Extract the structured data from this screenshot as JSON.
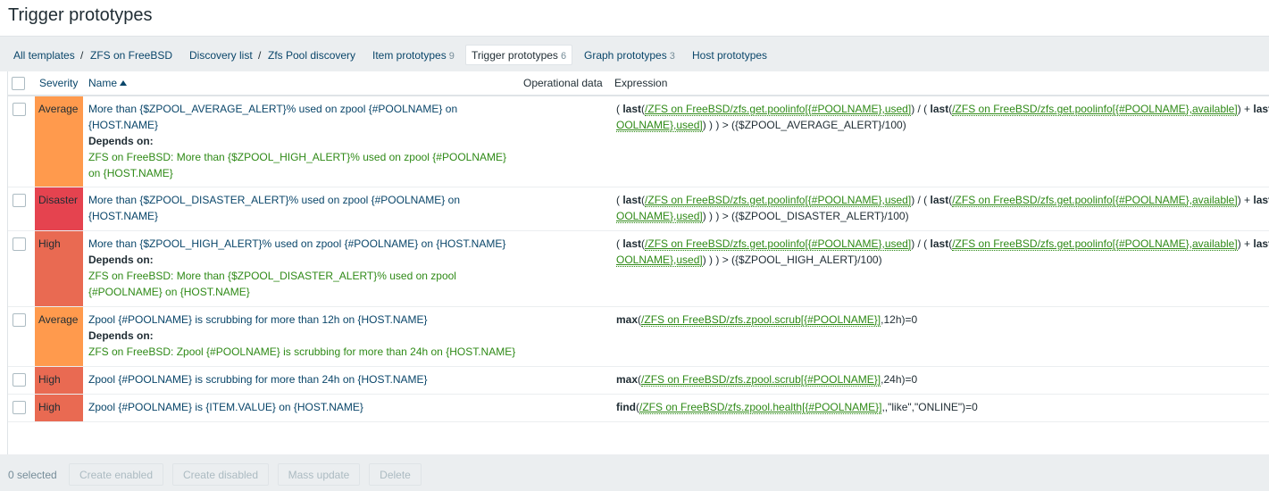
{
  "page": {
    "title": "Trigger prototypes"
  },
  "breadcrumb": {
    "all_templates": "All templates",
    "template": "ZFS on FreeBSD",
    "discovery_list": "Discovery list",
    "discovery_rule": "Zfs Pool discovery",
    "separator": "/",
    "item_prototypes": {
      "label": "Item prototypes",
      "count": "9"
    },
    "trigger_prototypes": {
      "label": "Trigger prototypes",
      "count": "6"
    },
    "graph_prototypes": {
      "label": "Graph prototypes",
      "count": "3"
    },
    "host_prototypes": {
      "label": "Host prototypes"
    }
  },
  "table": {
    "columns": {
      "severity": "Severity",
      "name": "Name",
      "operational_data": "Operational data",
      "expression": "Expression"
    },
    "rows": [
      {
        "severity": "Average",
        "name": "More than {$ZPOOL_AVERAGE_ALERT}% used on zpool {#POOLNAME} on {HOST.NAME}",
        "depends_label": "Depends on:",
        "depends": "ZFS on FreeBSD: More than {$ZPOOL_HIGH_ALERT}% used on zpool {#POOLNAME} on {HOST.NAME}",
        "expr": {
          "p1": "( ",
          "f1": "last",
          "p2": "(",
          "i1": "/ZFS on FreeBSD/zfs.get.poolinfo[{#POOLNAME},used]",
          "p3": ") / ( ",
          "f2": "last",
          "p4": "(",
          "i2": "/ZFS on FreeBSD/zfs.get.poolinfo[{#POOLNAME},available]",
          "p5": ") + ",
          "f3": "last",
          "i3": "OOLNAME},used]",
          "tail": ") ) ) > ({$ZPOOL_AVERAGE_ALERT}/100)"
        }
      },
      {
        "severity": "Disaster",
        "name": "More than {$ZPOOL_DISASTER_ALERT}% used on zpool {#POOLNAME} on {HOST.NAME}",
        "expr": {
          "p1": "( ",
          "f1": "last",
          "p2": "(",
          "i1": "/ZFS on FreeBSD/zfs.get.poolinfo[{#POOLNAME},used]",
          "p3": ") / ( ",
          "f2": "last",
          "p4": "(",
          "i2": "/ZFS on FreeBSD/zfs.get.poolinfo[{#POOLNAME},available]",
          "p5": ") + ",
          "f3": "last",
          "i3": "OOLNAME},used]",
          "tail": ") ) ) > ({$ZPOOL_DISASTER_ALERT}/100)"
        }
      },
      {
        "severity": "High",
        "name": "More than {$ZPOOL_HIGH_ALERT}% used on zpool {#POOLNAME} on {HOST.NAME}",
        "depends_label": "Depends on:",
        "depends": "ZFS on FreeBSD: More than {$ZPOOL_DISASTER_ALERT}% used on zpool {#POOLNAME} on {HOST.NAME}",
        "expr": {
          "p1": "( ",
          "f1": "last",
          "p2": "(",
          "i1": "/ZFS on FreeBSD/zfs.get.poolinfo[{#POOLNAME},used]",
          "p3": ") / ( ",
          "f2": "last",
          "p4": "(",
          "i2": "/ZFS on FreeBSD/zfs.get.poolinfo[{#POOLNAME},available]",
          "p5": ") + ",
          "f3": "last",
          "i3": "OOLNAME},used]",
          "tail": ") ) ) > ({$ZPOOL_HIGH_ALERT}/100)"
        }
      },
      {
        "severity": "Average",
        "name": "Zpool {#POOLNAME} is scrubbing for more than 12h on {HOST.NAME}",
        "depends_label": "Depends on:",
        "depends": "ZFS on FreeBSD: Zpool {#POOLNAME} is scrubbing for more than 24h on {HOST.NAME}",
        "expr": {
          "f1": "max",
          "p2": "(",
          "i1": "/ZFS on FreeBSD/zfs.zpool.scrub[{#POOLNAME}]",
          "tail": ",12h)=0"
        }
      },
      {
        "severity": "High",
        "name": "Zpool {#POOLNAME} is scrubbing for more than 24h on {HOST.NAME}",
        "expr": {
          "f1": "max",
          "p2": "(",
          "i1": "/ZFS on FreeBSD/zfs.zpool.scrub[{#POOLNAME}]",
          "tail": ",24h)=0"
        }
      },
      {
        "severity": "High",
        "name": "Zpool {#POOLNAME} is {ITEM.VALUE} on {HOST.NAME}",
        "expr": {
          "f1": "find",
          "p2": "(",
          "i1": "/ZFS on FreeBSD/zfs.zpool.health[{#POOLNAME}]",
          "tail": ",,\"like\",\"ONLINE\")=0"
        }
      }
    ]
  },
  "footer": {
    "selected": "0 selected",
    "create_enabled": "Create enabled",
    "create_disabled": "Create disabled",
    "mass_update": "Mass update",
    "delete": "Delete"
  },
  "colors": {
    "average": "#ff9a4d",
    "high": "#e96a52",
    "disaster": "#e5434f",
    "link": "#0a466a",
    "dependency": "#2f8a17"
  }
}
